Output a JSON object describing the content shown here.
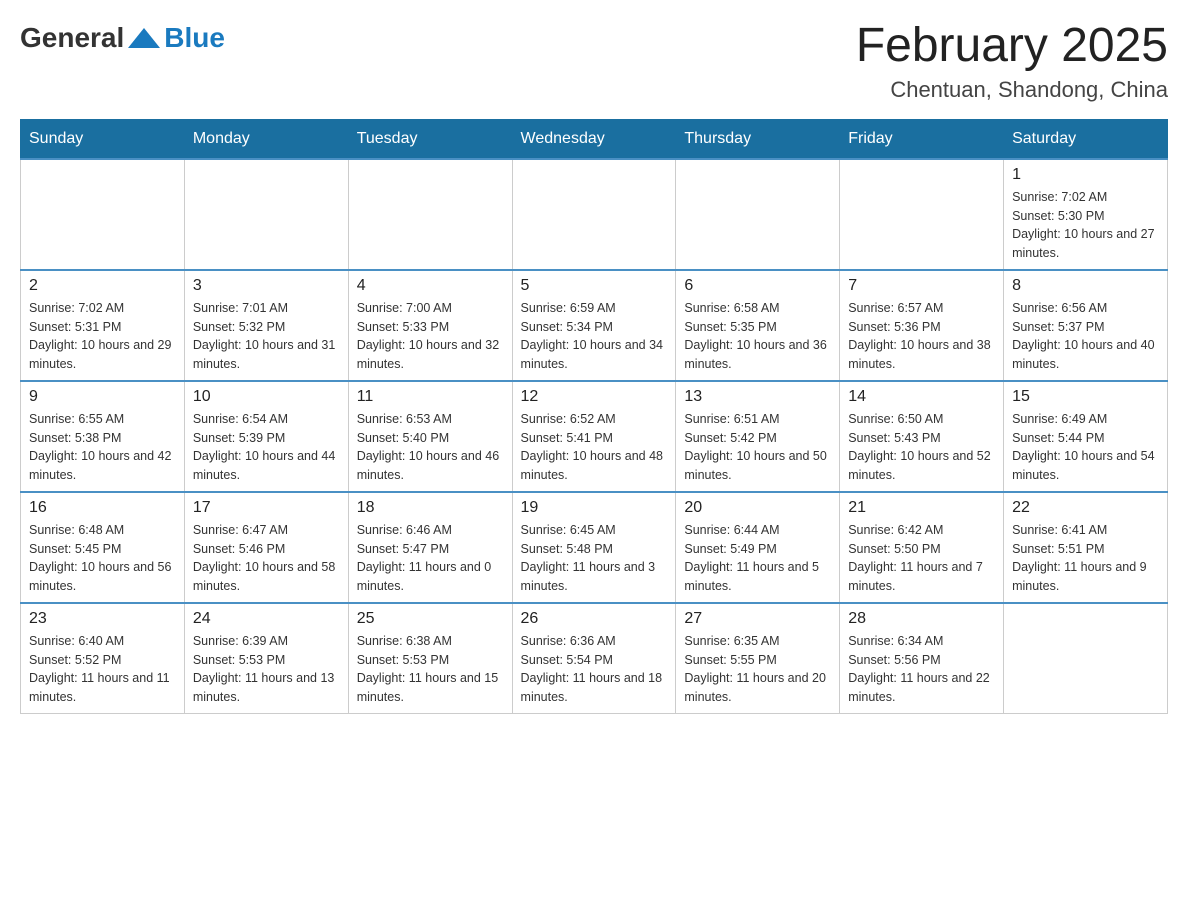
{
  "header": {
    "logo": {
      "general": "General",
      "blue": "Blue"
    },
    "title": "February 2025",
    "location": "Chentuan, Shandong, China"
  },
  "weekdays": [
    "Sunday",
    "Monday",
    "Tuesday",
    "Wednesday",
    "Thursday",
    "Friday",
    "Saturday"
  ],
  "weeks": [
    [
      {
        "day": "",
        "info": ""
      },
      {
        "day": "",
        "info": ""
      },
      {
        "day": "",
        "info": ""
      },
      {
        "day": "",
        "info": ""
      },
      {
        "day": "",
        "info": ""
      },
      {
        "day": "",
        "info": ""
      },
      {
        "day": "1",
        "info": "Sunrise: 7:02 AM\nSunset: 5:30 PM\nDaylight: 10 hours and 27 minutes."
      }
    ],
    [
      {
        "day": "2",
        "info": "Sunrise: 7:02 AM\nSunset: 5:31 PM\nDaylight: 10 hours and 29 minutes."
      },
      {
        "day": "3",
        "info": "Sunrise: 7:01 AM\nSunset: 5:32 PM\nDaylight: 10 hours and 31 minutes."
      },
      {
        "day": "4",
        "info": "Sunrise: 7:00 AM\nSunset: 5:33 PM\nDaylight: 10 hours and 32 minutes."
      },
      {
        "day": "5",
        "info": "Sunrise: 6:59 AM\nSunset: 5:34 PM\nDaylight: 10 hours and 34 minutes."
      },
      {
        "day": "6",
        "info": "Sunrise: 6:58 AM\nSunset: 5:35 PM\nDaylight: 10 hours and 36 minutes."
      },
      {
        "day": "7",
        "info": "Sunrise: 6:57 AM\nSunset: 5:36 PM\nDaylight: 10 hours and 38 minutes."
      },
      {
        "day": "8",
        "info": "Sunrise: 6:56 AM\nSunset: 5:37 PM\nDaylight: 10 hours and 40 minutes."
      }
    ],
    [
      {
        "day": "9",
        "info": "Sunrise: 6:55 AM\nSunset: 5:38 PM\nDaylight: 10 hours and 42 minutes."
      },
      {
        "day": "10",
        "info": "Sunrise: 6:54 AM\nSunset: 5:39 PM\nDaylight: 10 hours and 44 minutes."
      },
      {
        "day": "11",
        "info": "Sunrise: 6:53 AM\nSunset: 5:40 PM\nDaylight: 10 hours and 46 minutes."
      },
      {
        "day": "12",
        "info": "Sunrise: 6:52 AM\nSunset: 5:41 PM\nDaylight: 10 hours and 48 minutes."
      },
      {
        "day": "13",
        "info": "Sunrise: 6:51 AM\nSunset: 5:42 PM\nDaylight: 10 hours and 50 minutes."
      },
      {
        "day": "14",
        "info": "Sunrise: 6:50 AM\nSunset: 5:43 PM\nDaylight: 10 hours and 52 minutes."
      },
      {
        "day": "15",
        "info": "Sunrise: 6:49 AM\nSunset: 5:44 PM\nDaylight: 10 hours and 54 minutes."
      }
    ],
    [
      {
        "day": "16",
        "info": "Sunrise: 6:48 AM\nSunset: 5:45 PM\nDaylight: 10 hours and 56 minutes."
      },
      {
        "day": "17",
        "info": "Sunrise: 6:47 AM\nSunset: 5:46 PM\nDaylight: 10 hours and 58 minutes."
      },
      {
        "day": "18",
        "info": "Sunrise: 6:46 AM\nSunset: 5:47 PM\nDaylight: 11 hours and 0 minutes."
      },
      {
        "day": "19",
        "info": "Sunrise: 6:45 AM\nSunset: 5:48 PM\nDaylight: 11 hours and 3 minutes."
      },
      {
        "day": "20",
        "info": "Sunrise: 6:44 AM\nSunset: 5:49 PM\nDaylight: 11 hours and 5 minutes."
      },
      {
        "day": "21",
        "info": "Sunrise: 6:42 AM\nSunset: 5:50 PM\nDaylight: 11 hours and 7 minutes."
      },
      {
        "day": "22",
        "info": "Sunrise: 6:41 AM\nSunset: 5:51 PM\nDaylight: 11 hours and 9 minutes."
      }
    ],
    [
      {
        "day": "23",
        "info": "Sunrise: 6:40 AM\nSunset: 5:52 PM\nDaylight: 11 hours and 11 minutes."
      },
      {
        "day": "24",
        "info": "Sunrise: 6:39 AM\nSunset: 5:53 PM\nDaylight: 11 hours and 13 minutes."
      },
      {
        "day": "25",
        "info": "Sunrise: 6:38 AM\nSunset: 5:53 PM\nDaylight: 11 hours and 15 minutes."
      },
      {
        "day": "26",
        "info": "Sunrise: 6:36 AM\nSunset: 5:54 PM\nDaylight: 11 hours and 18 minutes."
      },
      {
        "day": "27",
        "info": "Sunrise: 6:35 AM\nSunset: 5:55 PM\nDaylight: 11 hours and 20 minutes."
      },
      {
        "day": "28",
        "info": "Sunrise: 6:34 AM\nSunset: 5:56 PM\nDaylight: 11 hours and 22 minutes."
      },
      {
        "day": "",
        "info": ""
      }
    ]
  ]
}
